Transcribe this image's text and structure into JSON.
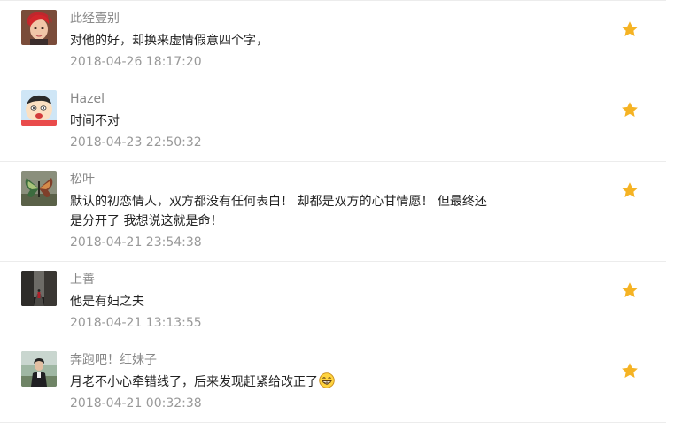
{
  "comments": [
    {
      "name": "此经壹别",
      "content": "对他的好，却换来虚情假意四个字，",
      "time": "2018-04-26 18:17:20",
      "avatar_icon": "avatar-red-hair-woman"
    },
    {
      "name": "Hazel",
      "content": "时间不对",
      "time": "2018-04-23 22:50:32",
      "avatar_icon": "avatar-cartoon-boy"
    },
    {
      "name": "松叶",
      "content_line1": "默认的初恋情人，双方都没有任何表白！ 却都是双方的心甘情愿！ 但最终还",
      "content_line2": "是分开了 我想说这就是命！",
      "time": "2018-04-21 23:54:38",
      "avatar_icon": "avatar-butterfly"
    },
    {
      "name": "上善",
      "content": "他是有妇之夫",
      "time": "2018-04-21 13:13:55",
      "avatar_icon": "avatar-dark-street"
    },
    {
      "name": "奔跑吧！红妹子",
      "content": "月老不小心牵错线了，后来发现赶紧给改正了",
      "time": "2018-04-21 00:32:38",
      "avatar_icon": "avatar-person-outdoors",
      "emoji": "grin-emoji"
    }
  ],
  "colors": {
    "star": "#f5b324",
    "name": "#888888",
    "time": "#999999",
    "divider": "#ececec"
  },
  "icons": {
    "favorite": "star-icon"
  }
}
